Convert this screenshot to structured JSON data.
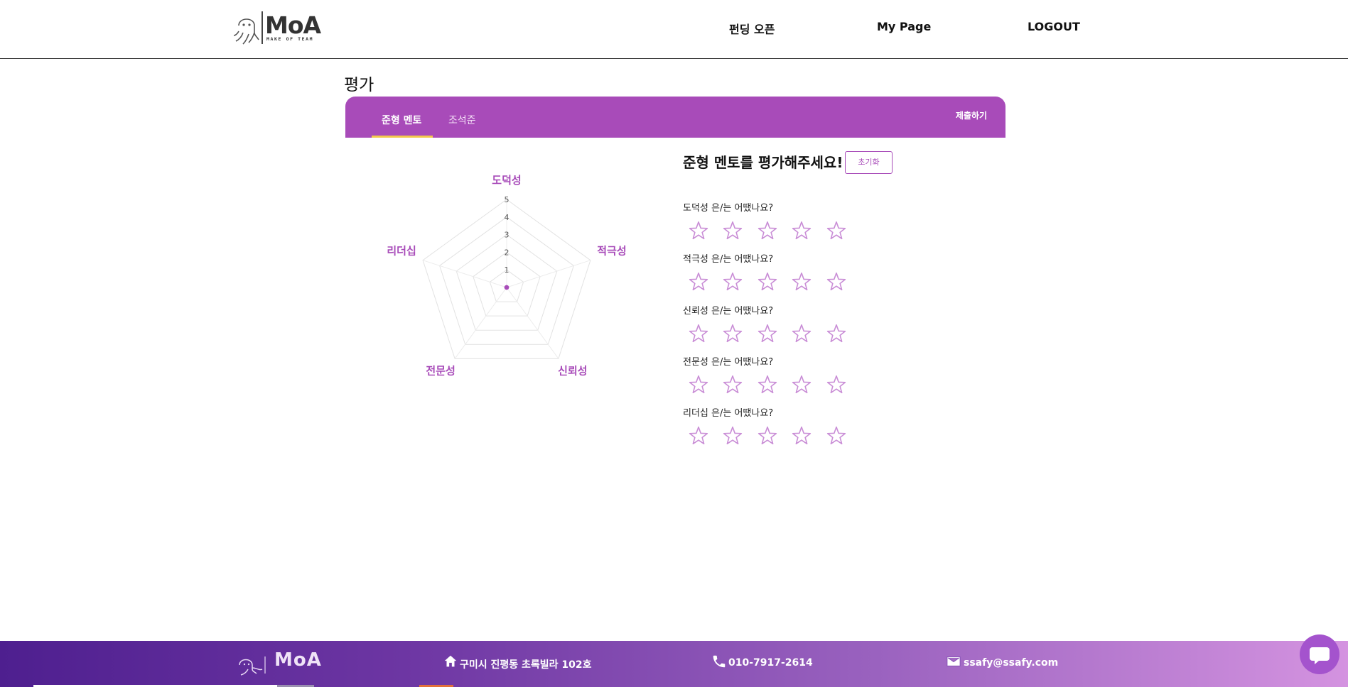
{
  "header": {
    "logo_text": "MoA",
    "logo_sub": "MAKE OF TEAM",
    "nav": [
      {
        "label": "펀딩 오픈"
      },
      {
        "label": "My Page"
      },
      {
        "label": "LOGOUT"
      }
    ]
  },
  "page": {
    "title": "평가"
  },
  "tabs": {
    "items": [
      {
        "label": "준형 멘토",
        "active": true
      },
      {
        "label": "조석준",
        "active": false
      }
    ],
    "submit_label": "제출하기"
  },
  "chart_data": {
    "type": "radar",
    "axes": [
      "도덕성",
      "적극성",
      "신뢰성",
      "전문성",
      "리더십"
    ],
    "scale_ticks": [
      "1",
      "2",
      "3",
      "4",
      "5"
    ],
    "range": [
      0,
      5
    ],
    "values": [
      0,
      0,
      0,
      0,
      0
    ],
    "color": "#a84bb9"
  },
  "evaluation": {
    "title": "준형 멘토를 평가해주세요!",
    "reset_label": "초기화",
    "questions": [
      {
        "label": "도덕성 은/는 어땠나요?",
        "rating": 0
      },
      {
        "label": "적극성 은/는 어땠나요?",
        "rating": 0
      },
      {
        "label": "신뢰성 은/는 어땠나요?",
        "rating": 0
      },
      {
        "label": "전문성 은/는 어땠나요?",
        "rating": 0
      },
      {
        "label": "리더십 은/는 어땠나요?",
        "rating": 0
      }
    ],
    "max_stars": 5
  },
  "footer": {
    "logo_text": "MoA",
    "address": "구미시 진평동 초록빌라 102호",
    "phone": "010-7917-2614",
    "email": "ssafy@ssafy.com",
    "icons": [
      "home-icon",
      "phone-icon",
      "mail-icon"
    ]
  },
  "colors": {
    "primary": "#a84bb9",
    "accent": "#f2c94c",
    "footer_start": "#4e1f8f",
    "footer_end": "#d493e0"
  }
}
